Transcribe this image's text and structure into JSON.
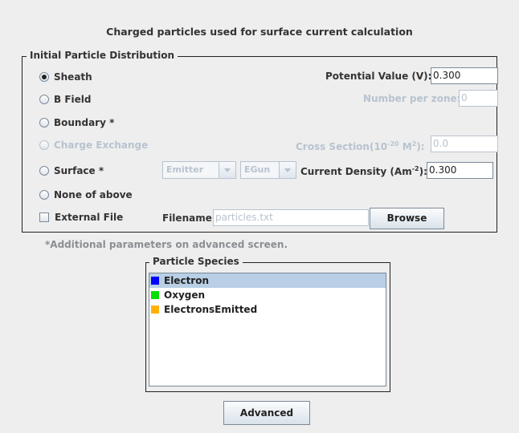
{
  "title": "Charged particles used for surface current calculation",
  "distribution": {
    "legend": "Initial Particle Distribution",
    "options": [
      {
        "label": "Sheath",
        "checked": true,
        "enabled": true
      },
      {
        "label": "B Field",
        "checked": false,
        "enabled": true
      },
      {
        "label": "Boundary *",
        "checked": false,
        "enabled": true
      },
      {
        "label": "Charge Exchange",
        "checked": false,
        "enabled": false
      },
      {
        "label": "Surface *",
        "checked": false,
        "enabled": true
      },
      {
        "label": "None of above",
        "checked": false,
        "enabled": true
      }
    ],
    "external_file": {
      "label": "External File",
      "checked": false
    },
    "potential": {
      "label": "Potential Value (V):",
      "value": "0.300"
    },
    "number_per_zone": {
      "label": "Number per zone:",
      "value": "0"
    },
    "cross_section": {
      "label_prefix": "Cross Section(10",
      "label_exp1": "-20",
      "label_mid": " M",
      "label_exp2": "2",
      "label_suffix": "):",
      "value": "0.0"
    },
    "emitter_combo": {
      "value": "Emitter"
    },
    "egun_combo": {
      "value": "EGun"
    },
    "current_density": {
      "label_prefix": "Current Density (Am",
      "label_exp": "-2",
      "label_suffix": "):",
      "value": "0.300"
    },
    "filename": {
      "label": "Filename:",
      "value": "particles.txt"
    },
    "browse_label": "Browse"
  },
  "note": "*Additional parameters on advanced screen.",
  "species": {
    "legend": "Particle Species",
    "items": [
      {
        "label": "Electron",
        "color": "#0000ff",
        "selected": true
      },
      {
        "label": "Oxygen",
        "color": "#00dd00",
        "selected": false
      },
      {
        "label": "ElectronsEmitted",
        "color": "#ffb000",
        "selected": false
      }
    ]
  },
  "advanced_label": "Advanced"
}
